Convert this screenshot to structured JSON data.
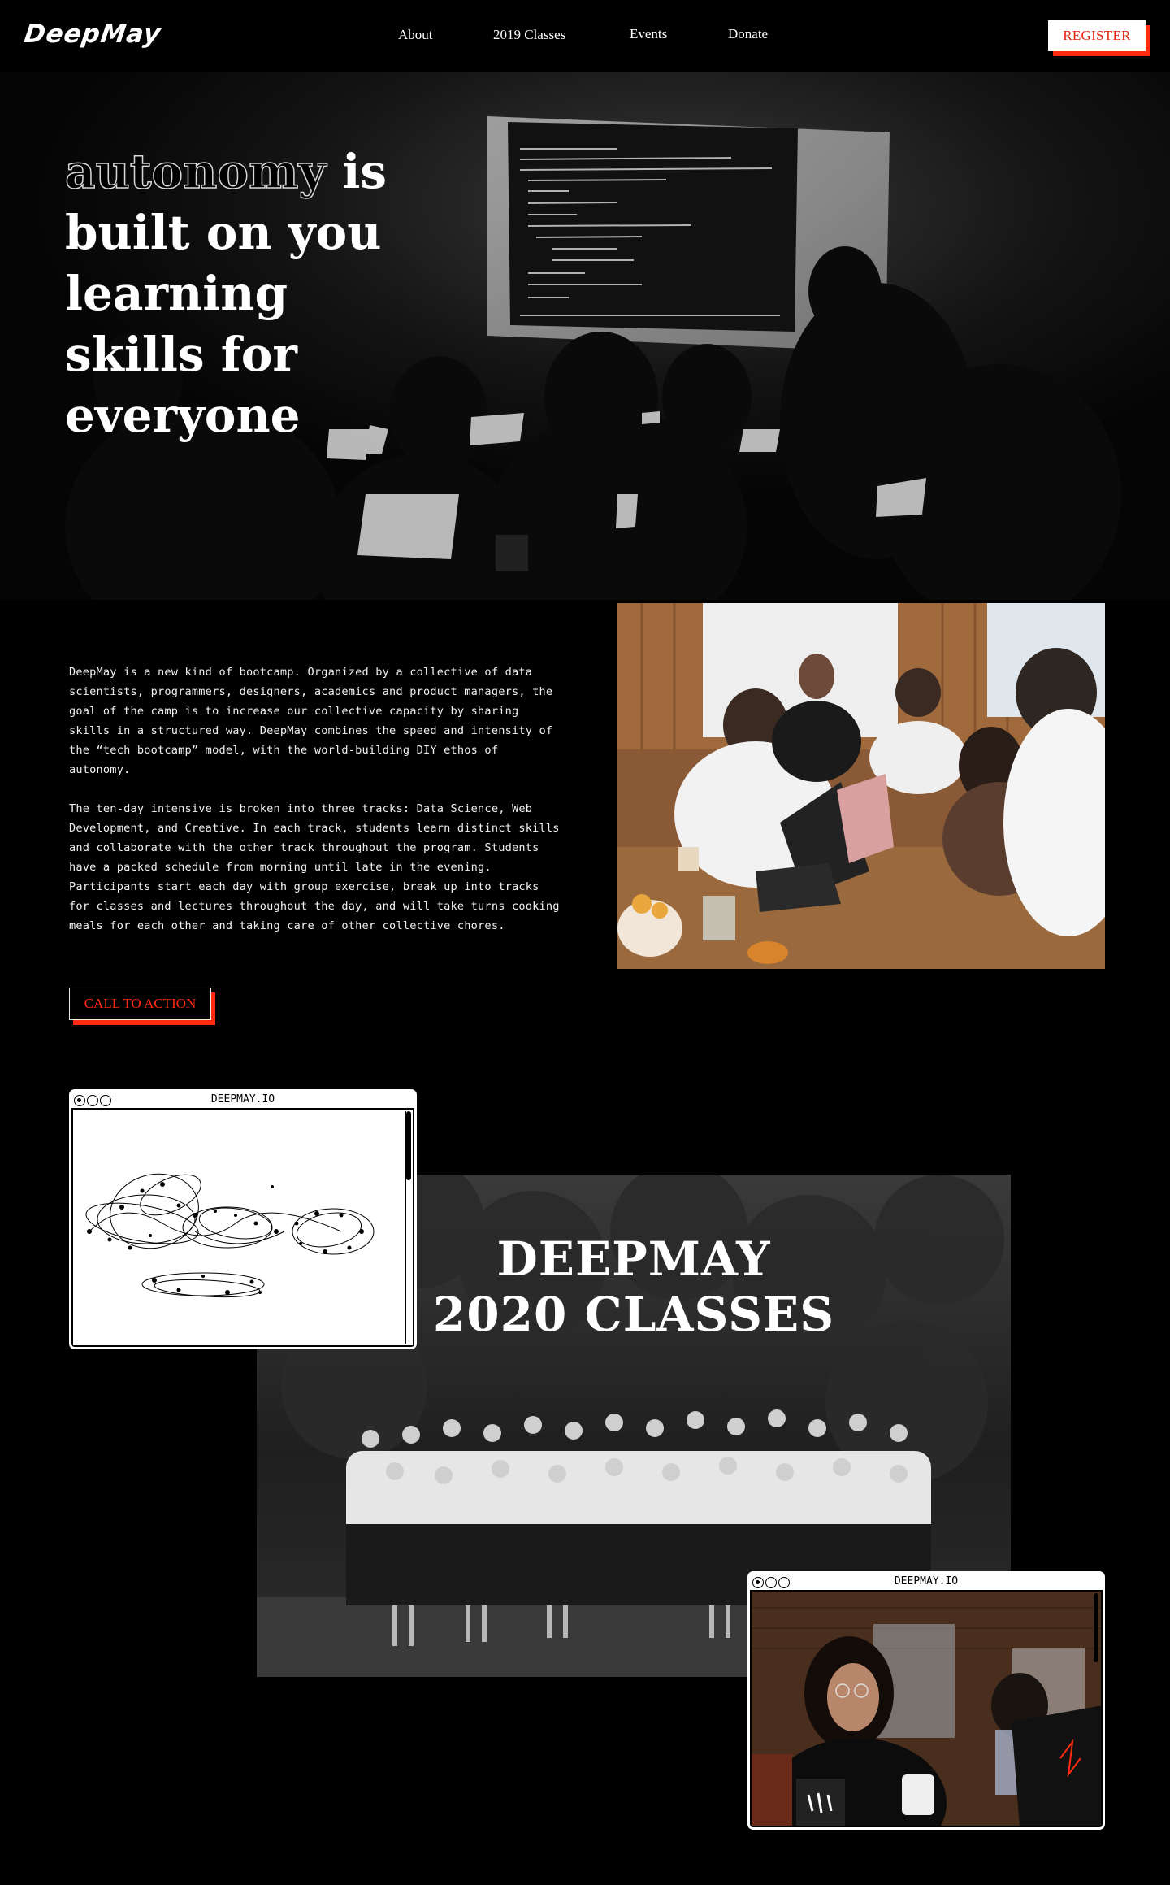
{
  "nav": {
    "logo": "DeepMay",
    "links": [
      "About",
      "2019 Classes",
      "Events",
      "Donate"
    ],
    "register_label": "REGISTER"
  },
  "hero": {
    "outlined_word": "autonomy",
    "headline_rest": " is built on you learning skills for everyone"
  },
  "about": {
    "paragraphs": [
      "DeepMay is a new kind of bootcamp. Organized by a collective of data scientists, programmers, designers, academics and product managers, the goal of the camp is to increase our collective capacity by sharing skills in a structured way. DeepMay combines the speed and intensity of the “tech bootcamp” model, with the world-building DIY ethos of autonomy.",
      "The ten-day intensive is broken into three tracks: Data Science, Web Development, and Creative. In each track, students learn distinct skills and collaborate with the other track throughout the program. Students have a packed schedule from morning until late in the evening. Participants start each day with group exercise, break up into tracks for classes and lectures throughout the day, and will take turns cooking meals for each other and taking care of other collective chores."
    ],
    "cta_label": "CALL TO ACTION"
  },
  "classes": {
    "title_line1": "DEEPMAY",
    "title_line2": "2020 CLASSES"
  },
  "windows": {
    "left_title": "DEEPMAY.IO",
    "right_title": "DEEPMAY.IO"
  },
  "colors": {
    "accent": "#ff2a0f",
    "background": "#000000",
    "text": "#ffffff"
  }
}
